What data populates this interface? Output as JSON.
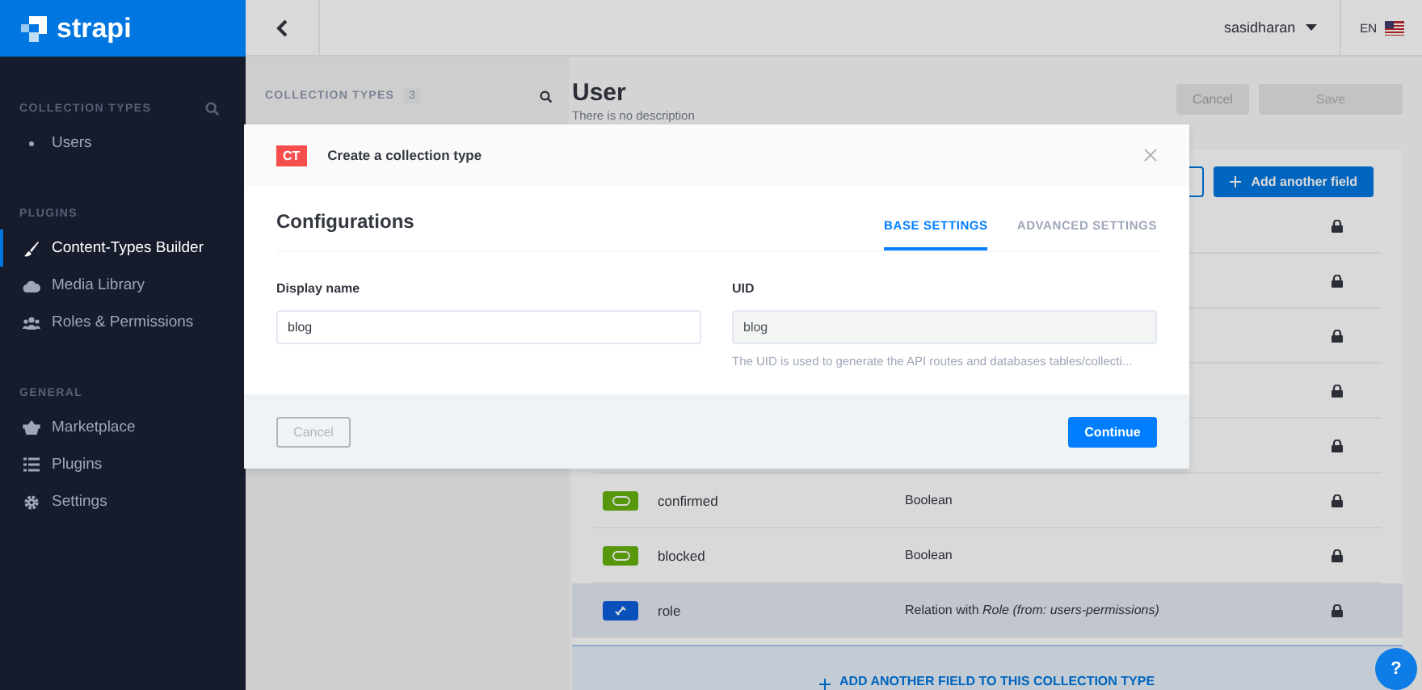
{
  "brand": {
    "name": "strapi"
  },
  "sidebar": {
    "sections": [
      {
        "title": "COLLECTION TYPES",
        "items": [
          {
            "label": "Users",
            "selected": false
          }
        ]
      },
      {
        "title": "PLUGINS",
        "items": [
          {
            "label": "Content-Types Builder",
            "selected": true
          },
          {
            "label": "Media Library",
            "selected": false
          },
          {
            "label": "Roles & Permissions",
            "selected": false
          }
        ]
      },
      {
        "title": "GENERAL",
        "items": [
          {
            "label": "Marketplace",
            "selected": false
          },
          {
            "label": "Plugins",
            "selected": false
          },
          {
            "label": "Settings",
            "selected": false
          }
        ]
      }
    ]
  },
  "header": {
    "user": "sasidharan",
    "language": "EN"
  },
  "subnav": {
    "title": "COLLECTION TYPES",
    "count": "3"
  },
  "content": {
    "title": "User",
    "description": "There is no description",
    "buttons": [
      {
        "label": "Cancel",
        "kind": "secondary"
      },
      {
        "label": "Save",
        "kind": "primary"
      }
    ],
    "add_field_button": "Add another field",
    "rows": [
      {
        "kind": "hidden",
        "locked": true
      },
      {
        "kind": "hidden",
        "locked": true
      },
      {
        "kind": "hidden",
        "locked": true
      },
      {
        "kind": "hidden",
        "locked": true
      },
      {
        "kind": "hidden",
        "locked": true
      },
      {
        "kind": "boolean",
        "name": "confirmed",
        "type": "Boolean",
        "locked": true,
        "selected": false
      },
      {
        "kind": "boolean",
        "name": "blocked",
        "type": "Boolean",
        "locked": true,
        "selected": false
      },
      {
        "kind": "relation",
        "name": "role",
        "type": "Relation with *Role (from: users-permissions)*",
        "locked": true,
        "selected": true
      }
    ],
    "add_field_link": "ADD ANOTHER FIELD TO THIS COLLECTION TYPE"
  },
  "modal": {
    "badge": "CT",
    "title": "Create a collection type",
    "heading": "Configurations",
    "tabs": [
      {
        "label": "BASE SETTINGS",
        "selected": true
      },
      {
        "label": "ADVANCED SETTINGS",
        "selected": false
      }
    ],
    "fields": [
      {
        "label": "Display name",
        "value": "blog",
        "disabled": false
      },
      {
        "label": "UID",
        "value": "blog",
        "disabled": true,
        "hint": "The UID is used to generate the API routes and databases tables/collecti..."
      }
    ],
    "cancel": "Cancel",
    "continue": "Continue"
  },
  "help": "?"
}
